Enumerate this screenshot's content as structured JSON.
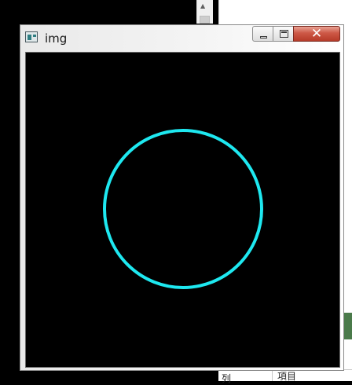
{
  "background": {
    "table_header": {
      "col_a": "列",
      "col_b": "項目"
    }
  },
  "window": {
    "title": "img",
    "icon": "image-window-icon",
    "controls": {
      "minimize": "minimize-icon",
      "maximize": "maximize-icon",
      "close": "close-icon",
      "close_glyph": "✕"
    },
    "close_color": "#c9493a"
  },
  "canvas": {
    "background_color": "#000000",
    "shape": "circle",
    "stroke_color": "#1ee8f0"
  }
}
